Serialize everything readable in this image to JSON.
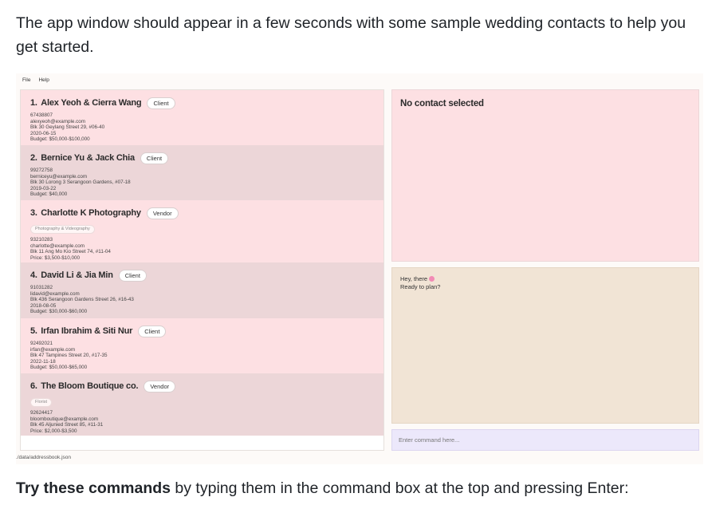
{
  "intro": "The app window should appear in a few seconds with some sample wedding contacts to help you get started.",
  "app": {
    "menu": [
      "File",
      "Help"
    ],
    "contacts": [
      {
        "index": "1.",
        "name": "Alex Yeoh & Cierra Wang",
        "type": "Client",
        "tag": "",
        "lines": [
          "67438807",
          "alexyeoh@example.com",
          "Blk 30 Geylang Street 29, #06-40",
          "2020-06-15",
          "Budget: $50,000-$100,000"
        ]
      },
      {
        "index": "2.",
        "name": "Bernice Yu & Jack Chia",
        "type": "Client",
        "tag": "",
        "lines": [
          "99272758",
          "berniceyu@example.com",
          "Blk 30 Lorong 3 Serangoon Gardens, #07-18",
          "2019-03-22",
          "Budget: $40,000"
        ]
      },
      {
        "index": "3.",
        "name": "Charlotte K Photography",
        "type": "Vendor",
        "tag": "Photography & Videography",
        "lines": [
          "93210283",
          "charlotte@example.com",
          "Blk 11 Ang Mo Kio Street 74, #11-04",
          "Price: $3,500-$10,000"
        ]
      },
      {
        "index": "4.",
        "name": "David Li & Jia Min",
        "type": "Client",
        "tag": "",
        "lines": [
          "91031282",
          "lidavid@example.com",
          "Blk 436 Serangoon Gardens Street 26, #16-43",
          "2018-08-05",
          "Budget: $30,000-$60,000"
        ]
      },
      {
        "index": "5.",
        "name": "Irfan Ibrahim & Siti Nur",
        "type": "Client",
        "tag": "",
        "lines": [
          "92492021",
          "irfan@example.com",
          "Blk 47 Tampines Street 20, #17-35",
          "2022-11-18",
          "Budget: $50,000-$65,000"
        ]
      },
      {
        "index": "6.",
        "name": "The Bloom Boutique co.",
        "type": "Vendor",
        "tag": "Florist",
        "lines": [
          "92624417",
          "bloomboutique@example.com",
          "Blk 45 Aljunied Street 85, #11-31",
          "Price: $2,000-$3,500"
        ]
      }
    ],
    "detail": {
      "empty_text": "No contact selected"
    },
    "chat": {
      "line1": "Hey, there",
      "line2": "Ready to plan?"
    },
    "command": {
      "placeholder": "Enter command here..."
    },
    "status": "./data/addressbook.json"
  },
  "outro": {
    "bold": "Try these commands",
    "rest": " by typing them in the command box at the top and pressing Enter:"
  }
}
